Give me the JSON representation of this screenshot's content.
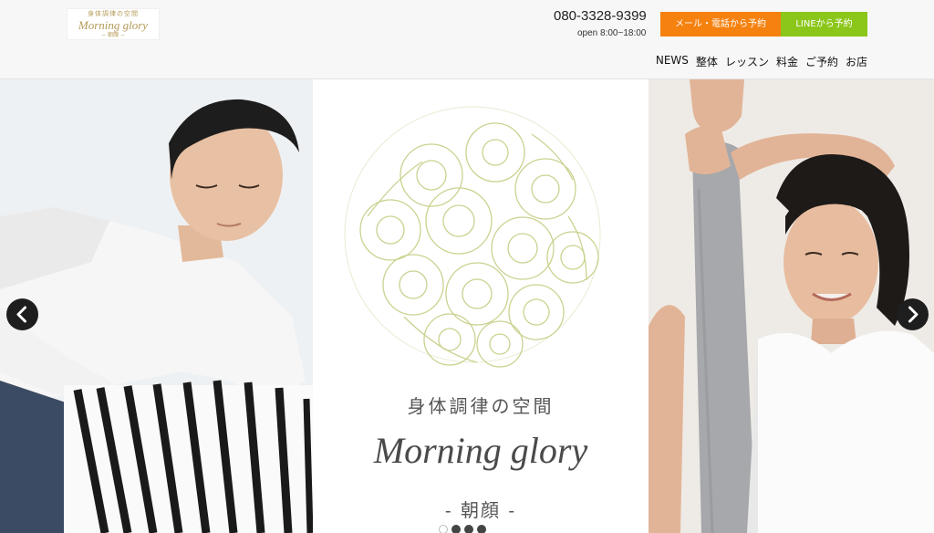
{
  "header": {
    "logo": {
      "line1": "身体調律の空間",
      "line2": "Morning glory",
      "line3": "− 朝顔 −"
    },
    "phone": "080-3328-9399",
    "hours": "open 8:00~18:00",
    "buttons": {
      "mail": "メール・電話から予約",
      "line": "LINEから予約"
    },
    "button_colors": {
      "mail": "#f5810f",
      "line": "#8bc61a"
    },
    "nav": [
      "NEWS",
      "整体",
      "レッスン",
      "料金",
      "ご予約",
      "お店"
    ]
  },
  "hero": {
    "title_jp": "身体調律の空間",
    "title_en": "Morning glory",
    "subtitle": "- 朝顔 -",
    "arrows": {
      "left": "chevron-left-icon",
      "right": "chevron-right-icon"
    },
    "slides": {
      "count": 4,
      "active_index": 0
    }
  }
}
